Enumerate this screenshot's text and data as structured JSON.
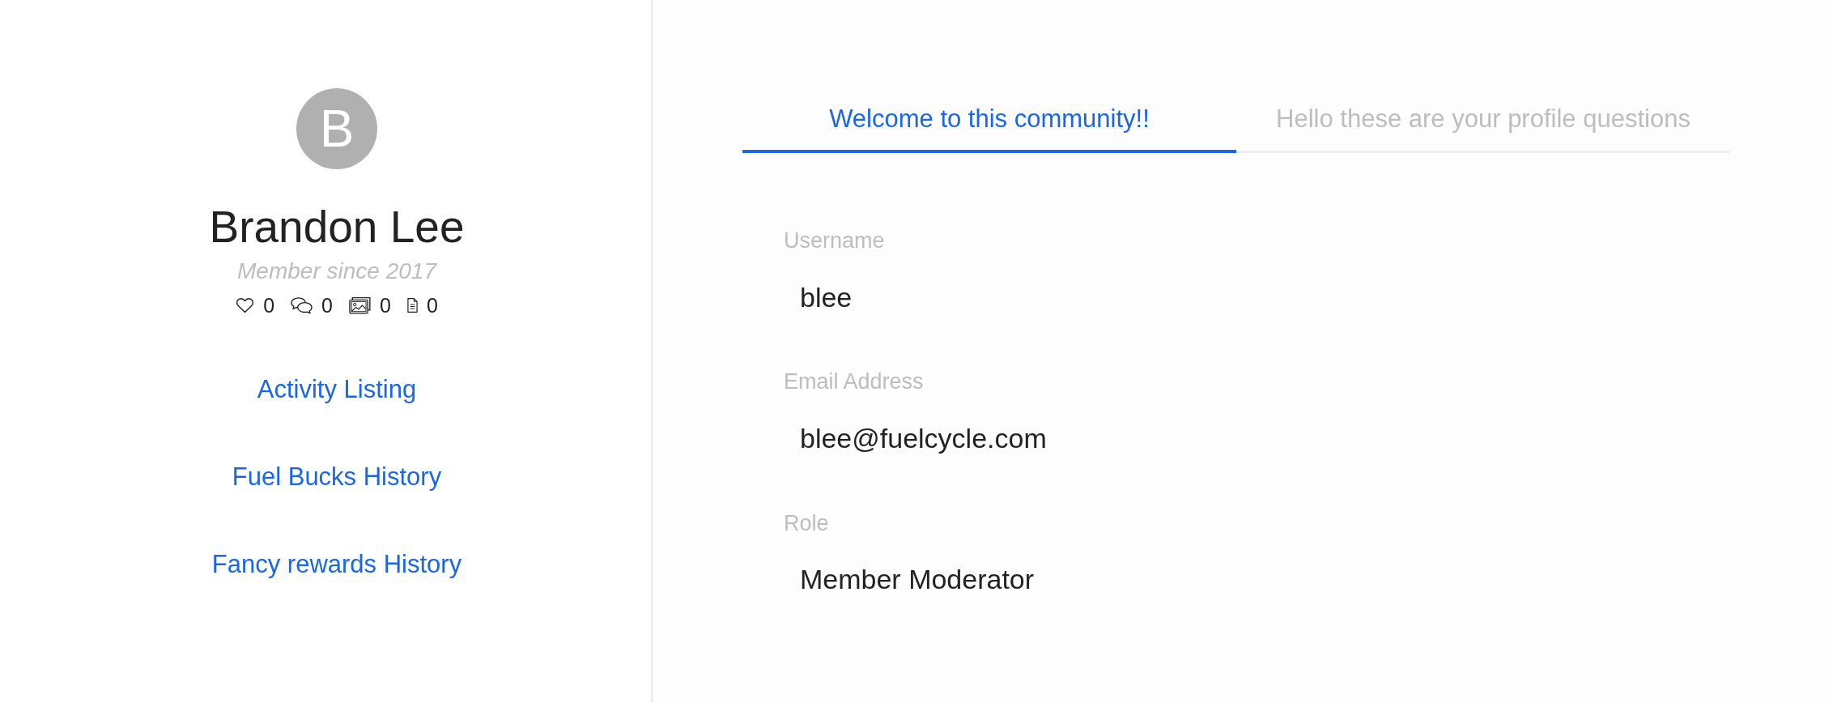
{
  "profile": {
    "avatar_initial": "B",
    "name": "Brandon Lee",
    "member_since": "Member since 2017",
    "stats": [
      {
        "kind": "likes",
        "count": "0"
      },
      {
        "kind": "comments",
        "count": "0"
      },
      {
        "kind": "images",
        "count": "0"
      },
      {
        "kind": "documents",
        "count": "0"
      }
    ]
  },
  "sidebar": {
    "links": [
      {
        "label": "Activity Listing"
      },
      {
        "label": "Fuel Bucks History"
      },
      {
        "label": "Fancy rewards History"
      }
    ]
  },
  "tabs": [
    {
      "label": "Welcome to this community!!",
      "selected": true
    },
    {
      "label": "Hello these are your profile questions",
      "selected": false
    }
  ],
  "fields": [
    {
      "label": "Username",
      "value": "blee"
    },
    {
      "label": "Email Address",
      "value": "blee@fuelcycle.com"
    },
    {
      "label": "Role",
      "value": "Member Moderator"
    }
  ]
}
